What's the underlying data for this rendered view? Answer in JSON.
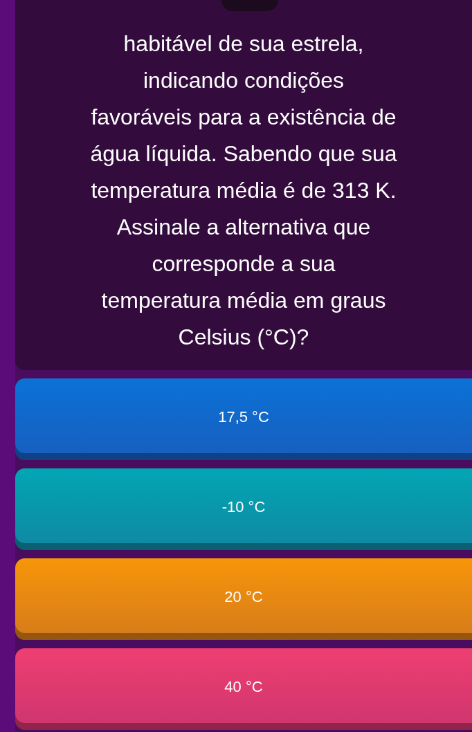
{
  "question": {
    "lines": [
      "habitável de sua estrela,",
      "indicando condições",
      "favoráveis para a existência de",
      "água líquida. Sabendo que sua",
      "temperatura média é de 313 K.",
      "Assinale a alternativa que",
      "corresponde a sua",
      "temperatura média em graus",
      "Celsius (°C)?"
    ]
  },
  "options": [
    {
      "label": "17,5 °C",
      "color": "#0b72d6"
    },
    {
      "label": "-10 °C",
      "color": "#02a6b4"
    },
    {
      "label": "20 °C",
      "color": "#f7960a"
    },
    {
      "label": "40 °C",
      "color": "#ee3f72"
    }
  ]
}
